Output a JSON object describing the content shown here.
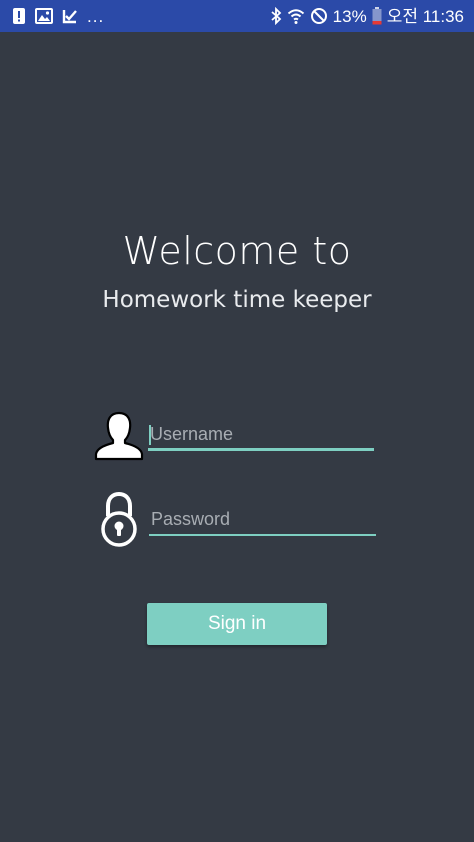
{
  "status_bar": {
    "notification_icons": [
      "alert-icon",
      "image-icon",
      "check-icon"
    ],
    "more": "...",
    "battery_percent": "13%",
    "time": "오전 11:36",
    "colors": {
      "background": "#2b4aa8",
      "battery_low": "#e53935"
    }
  },
  "login": {
    "welcome": "Welcome to",
    "app_name": "Homework time keeper",
    "username_placeholder": "Username",
    "password_placeholder": "Password",
    "signin_label": "Sign in",
    "colors": {
      "background": "#343a44",
      "accent": "#7ecfc2"
    }
  }
}
